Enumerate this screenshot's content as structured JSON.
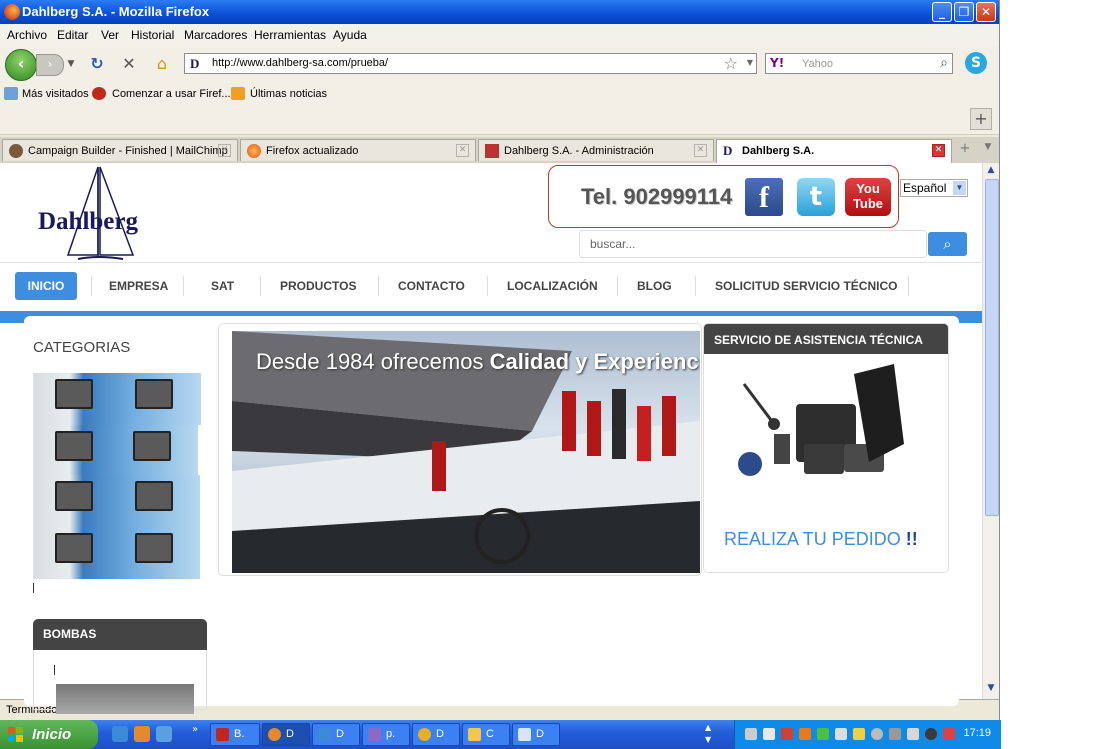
{
  "browser": {
    "title": "Dahlberg S.A. - Mozilla Firefox",
    "menu": [
      "Archivo",
      "Editar",
      "Ver",
      "Historial",
      "Marcadores",
      "Herramientas",
      "Ayuda"
    ],
    "url": "http://www.dahlberg-sa.com/prueba/",
    "search_placeholder": "Yahoo",
    "bookmarks": [
      "Más visitados",
      "Comenzar a usar Firef...",
      "Últimas noticias"
    ],
    "tabs": [
      {
        "label": "Campaign Builder - Finished | MailChimp",
        "active": false
      },
      {
        "label": "Firefox actualizado",
        "active": false
      },
      {
        "label": "Dahlberg S.A. - Administración",
        "active": false
      },
      {
        "label": "Dahlberg S.A.",
        "active": true
      }
    ],
    "status": "Terminado"
  },
  "site": {
    "logo_text": "Dahlberg",
    "phone": "Tel. 902999114",
    "social": {
      "facebook": "f",
      "twitter": "t",
      "youtube_top": "You",
      "youtube_bottom": "Tube"
    },
    "language": "Español",
    "search_placeholder": "buscar...",
    "nav": [
      {
        "label": "INICIO",
        "active": true
      },
      {
        "label": "EMPRESA",
        "active": false
      },
      {
        "label": "SAT",
        "active": false
      },
      {
        "label": "PRODUCTOS",
        "active": false
      },
      {
        "label": "CONTACTO",
        "active": false
      },
      {
        "label": "LOCALIZACIÓN",
        "active": false
      },
      {
        "label": "BLOG",
        "active": false
      },
      {
        "label": "SOLICITUD SERVICIO TÉCNICO",
        "active": false
      }
    ],
    "categories_title": "CATEGORIAS",
    "bombas_title": "BOMBAS",
    "slide_text_normal": "Desde 1984 ofrecemos ",
    "slide_text_bold": "Calidad y Experiencia",
    "sat_title": "SERVICIO DE ASISTENCIA TÉCNICA",
    "sat_cta": "REALIZA TU PEDIDO",
    "sat_cta_mark": "!!",
    "accent_color": "#3d8ee0"
  },
  "taskbar": {
    "start": "Inicio",
    "items": [
      {
        "label": "B.",
        "active": false
      },
      {
        "label": "D",
        "active": true
      },
      {
        "label": "D",
        "active": false
      },
      {
        "label": "p.",
        "active": false
      },
      {
        "label": "D",
        "active": false
      },
      {
        "label": "C",
        "active": false
      },
      {
        "label": "D",
        "active": false
      }
    ],
    "clock": "17:19"
  }
}
